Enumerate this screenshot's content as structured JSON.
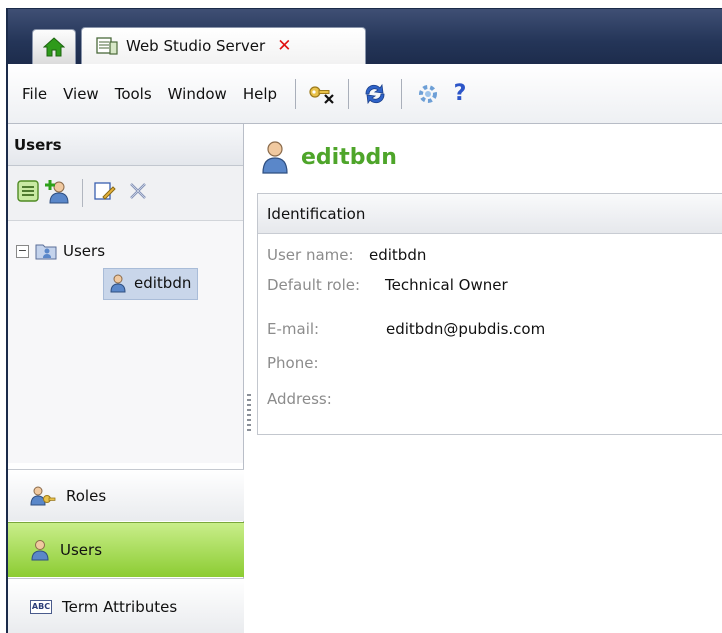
{
  "tabs": {
    "home_icon": "home-icon",
    "active_title": "Web Studio Server",
    "close_symbol": "✕"
  },
  "menu": {
    "items": [
      "File",
      "View",
      "Tools",
      "Window",
      "Help"
    ]
  },
  "toolbar_icons": [
    "key-remove-icon",
    "refresh-icon",
    "settings-icon",
    "help-icon"
  ],
  "help_glyph": "?",
  "left_panel": {
    "header": "Users",
    "tree": {
      "root_label": "Users",
      "expander": "⊟",
      "children": [
        "editbdn"
      ]
    },
    "nav": {
      "roles": "Roles",
      "users": "Users",
      "term_attributes": "Term Attributes",
      "abc_badge": "ABC"
    }
  },
  "content": {
    "user_title": "editbdn",
    "section_title": "Identification",
    "fields": {
      "user_name_label": "User name:",
      "user_name_value": "editbdn",
      "default_role_label": "Default role:",
      "default_role_value": "Technical Owner",
      "email_label": "E-mail:",
      "email_value": "editbdn@pubdis.com",
      "phone_label": "Phone:",
      "address_label": "Address:"
    }
  },
  "colors": {
    "accent_green": "#4ea52a",
    "active_nav": "#8ccc33",
    "close_red": "#e01010"
  }
}
